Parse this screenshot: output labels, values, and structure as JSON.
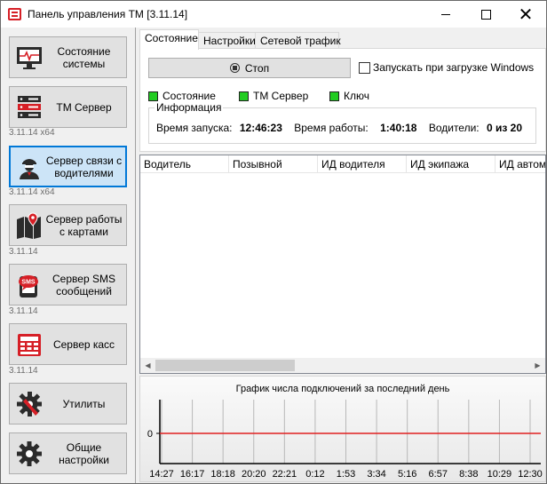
{
  "window": {
    "title": "Панель управления ТМ [3.11.14]",
    "close_glyph": "✕"
  },
  "sidebar": {
    "items": [
      {
        "label": "Состояние системы",
        "icon": "monitor-heartbeat-icon",
        "version": ""
      },
      {
        "label": "ТМ Сервер",
        "icon": "server-rack-icon",
        "version": "3.11.14 x64"
      },
      {
        "label": "Сервер связи с водителями",
        "icon": "driver-icon",
        "version": "3.11.14 x64",
        "active": true
      },
      {
        "label": "Сервер работы с картами",
        "icon": "map-pin-icon",
        "version": "3.11.14"
      },
      {
        "label": "Сервер SMS сообщений",
        "icon": "sms-bubble-icon",
        "version": "3.11.14"
      },
      {
        "label": "Сервер касс",
        "icon": "cash-register-icon",
        "version": "3.11.14"
      },
      {
        "label": "Утилиты",
        "icon": "gear-wrench-icon",
        "version": ""
      },
      {
        "label": "Общие настройки",
        "icon": "gear-icon",
        "version": ""
      }
    ]
  },
  "tabs": [
    "Состояние",
    "Настройки",
    "Сетевой трафик"
  ],
  "status": {
    "stop_label": "Стоп",
    "autostart_label": "Запускать при загрузке Windows",
    "autostart_checked": false,
    "indicators": [
      {
        "label": "Состояние",
        "color": "#22cc22"
      },
      {
        "label": "ТМ Сервер",
        "color": "#22cc22"
      },
      {
        "label": "Ключ",
        "color": "#22cc22"
      }
    ]
  },
  "info": {
    "title": "Информация",
    "start_label": "Время запуска:",
    "start_value": "12:46:23",
    "uptime_label": "Время работы:",
    "uptime_value": "1:40:18",
    "drivers_label": "Водители:",
    "drivers_value": "0 из 20"
  },
  "table": {
    "columns": [
      "Водитель",
      "Позывной",
      "ИД водителя",
      "ИД экипажа",
      "ИД автом"
    ],
    "rows": []
  },
  "chart_data": {
    "type": "line",
    "title": "График числа подключений за последний день",
    "xlabel": "",
    "ylabel": "",
    "x": [
      "14:27",
      "16:17",
      "18:18",
      "20:20",
      "22:21",
      "0:12",
      "1:53",
      "3:34",
      "5:16",
      "6:57",
      "8:38",
      "10:29",
      "12:30"
    ],
    "series": [
      {
        "values": [
          0,
          0,
          0,
          0,
          0,
          0,
          0,
          0,
          0,
          0,
          0,
          0,
          0
        ],
        "color": "#e02020"
      }
    ],
    "y_ticks": [
      0
    ],
    "grid": true
  }
}
